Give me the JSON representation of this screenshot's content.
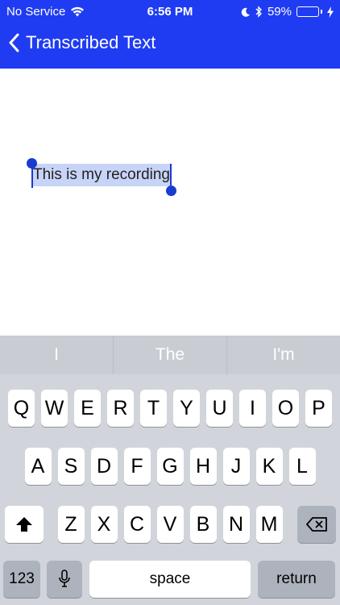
{
  "status_bar": {
    "carrier": "No Service",
    "time": "6:56 PM",
    "battery": "59%",
    "battery_level": 0.59
  },
  "nav": {
    "title": "Transcribed Text"
  },
  "editor": {
    "selected_text": "This is my recording"
  },
  "keyboard": {
    "suggestions": [
      "I",
      "The",
      "I'm"
    ],
    "row1": [
      "Q",
      "W",
      "E",
      "R",
      "T",
      "Y",
      "U",
      "I",
      "O",
      "P"
    ],
    "row2": [
      "A",
      "S",
      "D",
      "F",
      "G",
      "H",
      "J",
      "K",
      "L"
    ],
    "row3": [
      "Z",
      "X",
      "C",
      "V",
      "B",
      "N",
      "M"
    ],
    "num_label": "123",
    "space_label": "space",
    "return_label": "return"
  },
  "colors": {
    "header": "#1f3cf2",
    "selection": "#c8d4f7",
    "handle": "#1a3bd1",
    "keyboard_bg": "#d1d5db"
  },
  "icons": {
    "wifi": "wifi-icon",
    "moon": "moon-icon",
    "bluetooth": "bluetooth-icon",
    "charging": "bolt-icon",
    "back": "chevron-left-icon",
    "shift": "shift-arrow-icon",
    "backspace": "backspace-icon",
    "mic": "microphone-icon"
  }
}
